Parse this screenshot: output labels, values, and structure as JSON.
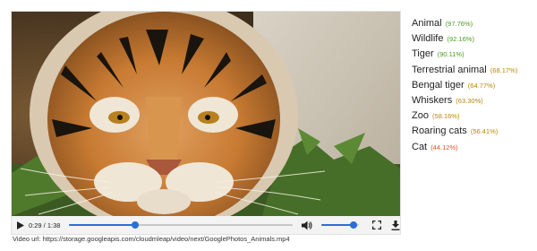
{
  "labels": [
    {
      "name": "Animal",
      "score": "(97.76%)",
      "color": "#4a9a1f"
    },
    {
      "name": "Wildlife",
      "score": "(92.16%)",
      "color": "#4a9a1f"
    },
    {
      "name": "Tiger",
      "score": "(90.11%)",
      "color": "#4a9a1f"
    },
    {
      "name": "Terrestrial animal",
      "score": "(68.17%)",
      "color": "#b8860b"
    },
    {
      "name": "Bengal tiger",
      "score": "(64.77%)",
      "color": "#b8860b"
    },
    {
      "name": "Whiskers",
      "score": "(63.30%)",
      "color": "#b8860b"
    },
    {
      "name": "Zoo",
      "score": "(58.16%)",
      "color": "#b8860b"
    },
    {
      "name": "Roaring cats",
      "score": "(56.41%)",
      "color": "#b8860b"
    },
    {
      "name": "Cat",
      "score": "(44.12%)",
      "color": "#d4582a"
    }
  ],
  "player": {
    "time": "0:29 / 1:38",
    "progress": 0.295,
    "volume": 0.85,
    "accent": "#2a6fd6",
    "icons": {
      "play": "play-icon",
      "volume": "volume-icon",
      "fullscreen": "fullscreen-icon",
      "download": "download-icon"
    }
  },
  "video_url_text": "Video url: https://storage.googleapis.com/cloudmleap/video/next/GooglePhotos_Animals.mp4"
}
